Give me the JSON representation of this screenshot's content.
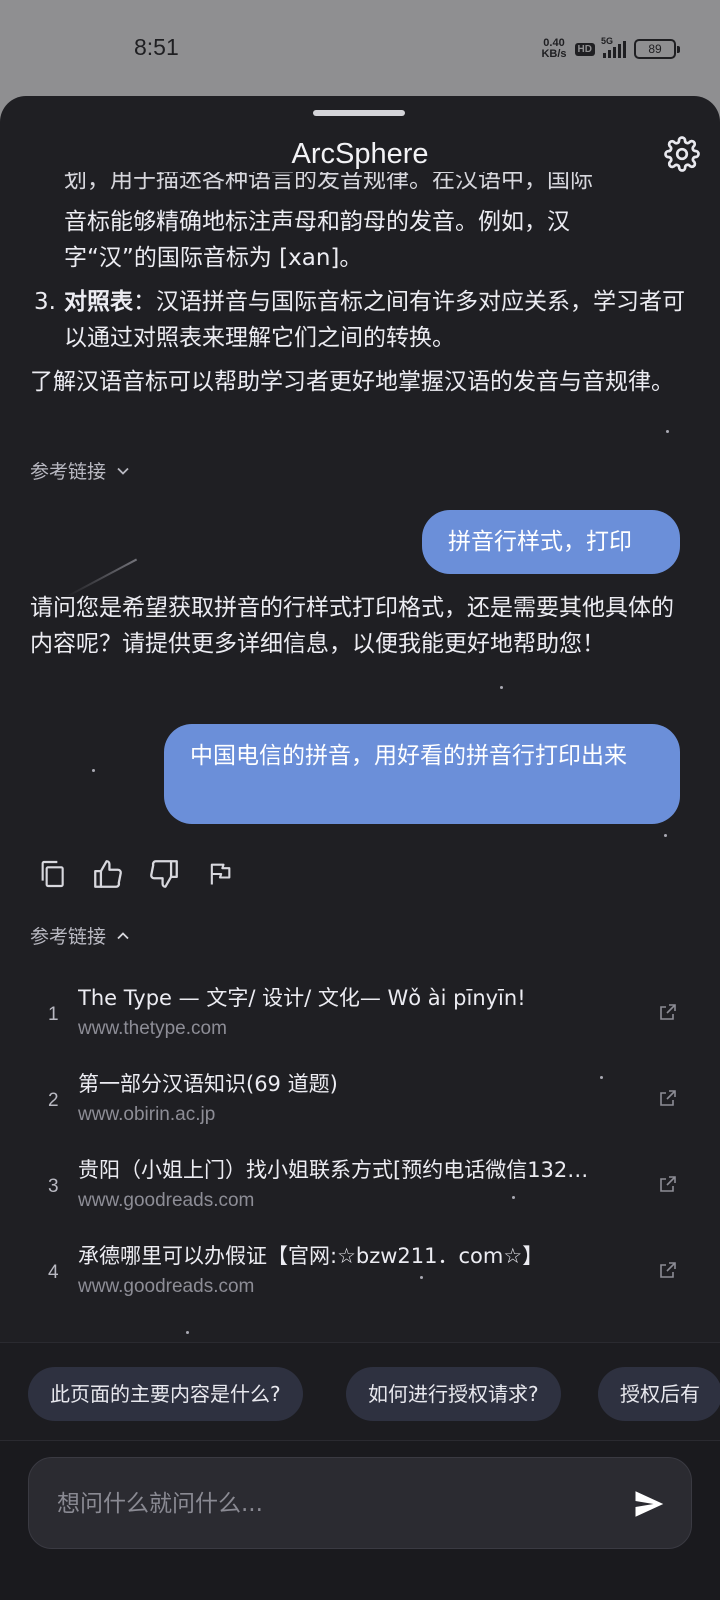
{
  "status": {
    "time": "8:51",
    "net_speed_value": "0.40",
    "net_speed_unit": "KB/s",
    "hd": "HD",
    "network": "5G",
    "battery": "89"
  },
  "header": {
    "title": "ArcSphere",
    "settings_icon": "gear-icon"
  },
  "chat": {
    "ai_top_partial": "划，用于描述各种语言的发音规律。在汉语中，国际",
    "item2_continuation_line1": "音标能够精确地标注声母和韵母的发音。例如，汉",
    "item2_continuation_line2": "字“汉”的国际音标为 [xan]。",
    "item3_number": "3.",
    "item3_bold": "对照表",
    "item3_text": "：汉语拼音与国际音标之间有许多对应关系，学习者可以通过对照表来理解它们之间的转换。",
    "summary": "了解汉语音标可以帮助学习者更好地掌握汉语的发音与音规律。",
    "ref_toggle_1": "参考链接",
    "user_msg_1": "拼音行样式，打印",
    "ai_reply_2": "请问您是希望获取拼音的行样式打印格式，还是需要其他具体的内容呢？请提供更多详细信息，以便我能更好地帮助您！",
    "user_msg_2": "中国电信的拼音，用好看的拼音行打印出来",
    "ref_toggle_2": "参考链接"
  },
  "actions": [
    "copy-icon",
    "thumbs-up-icon",
    "thumbs-down-icon",
    "flag-icon"
  ],
  "references": [
    {
      "num": "1",
      "title": "The Type — 文字/ 设计/ 文化— Wǒ ài pīnyīn!",
      "url": "www.thetype.com"
    },
    {
      "num": "2",
      "title": "第一部分汉语知识(69 道题)",
      "url": "www.obirin.ac.jp"
    },
    {
      "num": "3",
      "title": "贵阳（小姐上门）找小姐联系方式[预约电话微信132…",
      "url": "www.goodreads.com"
    },
    {
      "num": "4",
      "title": "承德哪里可以办假证【官网:☆bzw211．com☆】",
      "url": "www.goodreads.com"
    }
  ],
  "suggestions": [
    "此页面的主要内容是什么?",
    "如何进行授权请求?",
    "授权后有"
  ],
  "input": {
    "placeholder": "想问什么就问什么..."
  }
}
